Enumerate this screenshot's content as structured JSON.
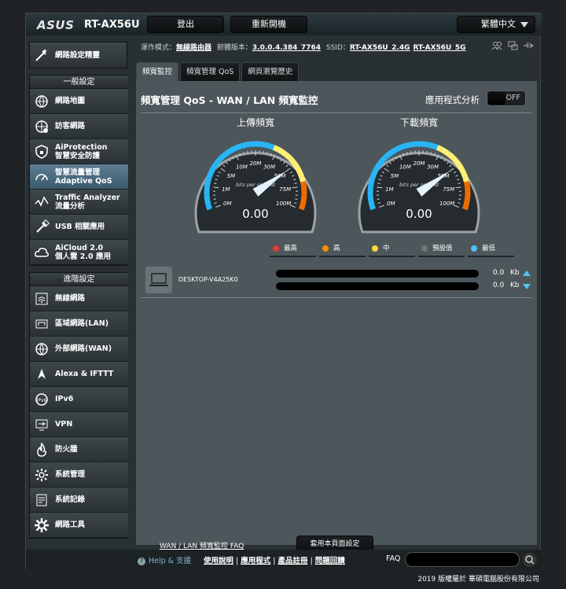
{
  "header": {
    "brand": "ASUS",
    "model": "RT-AX56U",
    "logout_label": "登出",
    "reboot_label": "重新開機",
    "language": "繁體中文"
  },
  "info": {
    "mode_label": "運作模式：",
    "mode_value": "無線路由器",
    "fw_label": "韌體版本：",
    "fw_value": "3.0.0.4.384_7764",
    "ssid_label": "SSID：",
    "ssid_24": "RT-AX56U_2.4G",
    "ssid_5": "RT-AX56U_5G"
  },
  "sidebar": {
    "quick_setup": "網路設定精靈",
    "general_title": "一般設定",
    "general": [
      {
        "label": "網路地圖",
        "icon": "network-map-icon"
      },
      {
        "label": "訪客網路",
        "icon": "guest-network-icon"
      },
      {
        "label": "AiProtection\n智慧安全防護",
        "icon": "shield-icon"
      },
      {
        "label": "智慧流量管理\nAdaptive QoS",
        "icon": "qos-gauge-icon"
      },
      {
        "label": "Traffic Analyzer\n流量分析",
        "icon": "traffic-icon"
      },
      {
        "label": "USB 相關應用",
        "icon": "usb-icon"
      },
      {
        "label": "AiCloud 2.0\n個人雲 2.0 應用",
        "icon": "cloud-icon"
      }
    ],
    "advanced_title": "進階設定",
    "advanced": [
      {
        "label": "無線網路",
        "icon": "wireless-icon"
      },
      {
        "label": "區域網路(LAN)",
        "icon": "lan-icon"
      },
      {
        "label": "外部網路(WAN)",
        "icon": "wan-icon"
      },
      {
        "label": "Alexa & IFTTT",
        "icon": "alexa-icon"
      },
      {
        "label": "IPv6",
        "icon": "ipv6-icon"
      },
      {
        "label": "VPN",
        "icon": "vpn-icon"
      },
      {
        "label": "防火牆",
        "icon": "firewall-icon"
      },
      {
        "label": "系統管理",
        "icon": "admin-gear-icon"
      },
      {
        "label": "系統記錄",
        "icon": "log-icon"
      },
      {
        "label": "網路工具",
        "icon": "tools-gear-icon"
      }
    ]
  },
  "tabs": [
    "頻寬監控",
    "頻寬管理 QoS",
    "網頁瀏覽歷史"
  ],
  "main": {
    "title": "頻寬管理 QoS - WAN / LAN 頻寬監控",
    "app_analysis": "應用程式分析",
    "toggle": "OFF",
    "upload_title": "上傳頻寬",
    "download_title": "下載頻寬",
    "gauge_ticks": [
      "0M",
      "1M",
      "5M",
      "10M",
      "20M",
      "30M",
      "50M",
      "75M",
      "100M"
    ],
    "gauge_unit": "bits per second",
    "upload_value": "0.00",
    "download_value": "0.00",
    "priorities": [
      {
        "label": "最高",
        "color": "#e53935"
      },
      {
        "label": "高",
        "color": "#fb8c00"
      },
      {
        "label": "中",
        "color": "#fdd835"
      },
      {
        "label": "預設值",
        "color": "#757575"
      },
      {
        "label": "最低",
        "color": "#4fc3f7"
      }
    ],
    "device": {
      "name": "DESKTOP-V4A25K0",
      "up_rate": "0.0",
      "down_rate": "0.0",
      "unit": "Kb"
    },
    "faq_link": "WAN / LAN 頻寬監控 FAQ",
    "apply": "套用本頁面設定"
  },
  "footer": {
    "help": "Help & 支援",
    "links": [
      "使用說明",
      "應用程式",
      "產品註冊",
      "問題回饋"
    ],
    "faq_label": "FAQ",
    "copyright": "2019 版權屬於 華碩電腦股份有限公司"
  }
}
